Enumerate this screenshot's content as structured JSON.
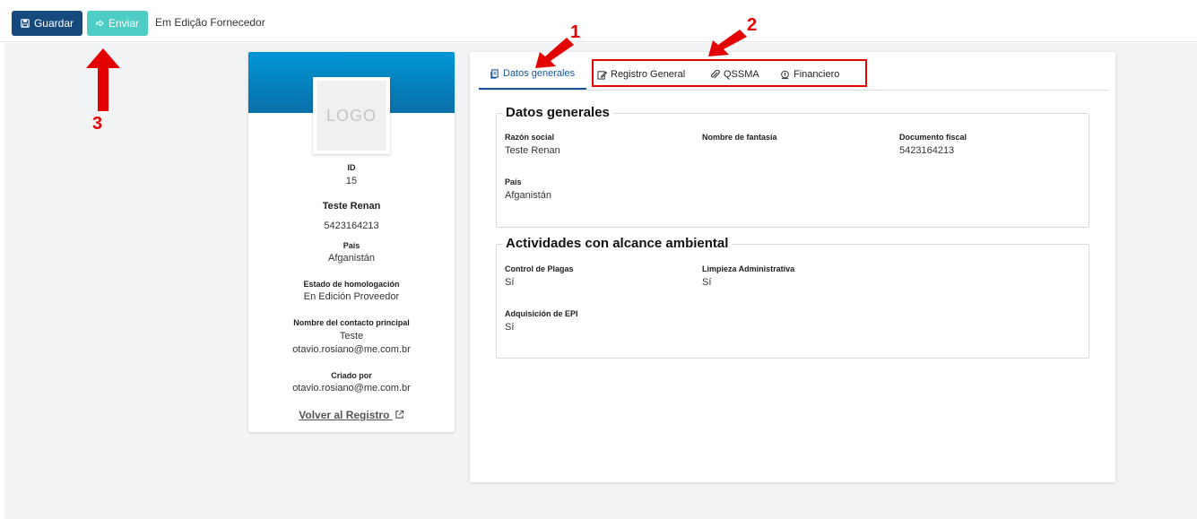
{
  "toolbar": {
    "save_label": "Guardar",
    "send_label": "Enviar",
    "status": "Em Edição Fornecedor"
  },
  "profile": {
    "logo_text": "LOGO",
    "id_label": "ID",
    "id_value": "15",
    "name": "Teste Renan",
    "fiscal": "5423164213",
    "country_label": "País",
    "country_value": "Afganistán",
    "homolog_label": "Estado de homologación",
    "homolog_value": "En Edición Proveedor",
    "contact_label": "Nombre del contacto principal",
    "contact_name": "Teste",
    "contact_email": "otavio.rosiano@me.com.br",
    "created_label": "Criado por",
    "created_value": "otavio.rosiano@me.com.br",
    "back_link": "Volver al Registro"
  },
  "tabs": [
    {
      "label": "Datos generales",
      "icon": "document-icon",
      "active": true
    },
    {
      "label": "Registro General",
      "icon": "edit-icon"
    },
    {
      "label": "QSSMA",
      "icon": "paperclip-icon"
    },
    {
      "label": "Financiero",
      "icon": "coin-icon"
    }
  ],
  "general": {
    "title": "Datos generales",
    "razon_label": "Razón social",
    "razon_value": "Teste Renan",
    "fantasia_label": "Nombre de fantasía",
    "fantasia_value": "",
    "doc_label": "Documento fiscal",
    "doc_value": "5423164213",
    "pais_label": "País",
    "pais_value": "Afganistán"
  },
  "activities": {
    "title": "Actividades con alcance ambiental",
    "plagas_label": "Control de Plagas",
    "plagas_value": "Sí",
    "limpieza_label": "Limpieza Administrativa",
    "limpieza_value": "Sí",
    "epi_label": "Adquisición de EPI",
    "epi_value": "Sí"
  },
  "annotations": {
    "n1": "1",
    "n2": "2",
    "n3": "3",
    "color": "#e30000"
  },
  "colors": {
    "primary": "#174a7c",
    "accent": "#4ecdc4",
    "tab_active": "#1a56a0"
  }
}
